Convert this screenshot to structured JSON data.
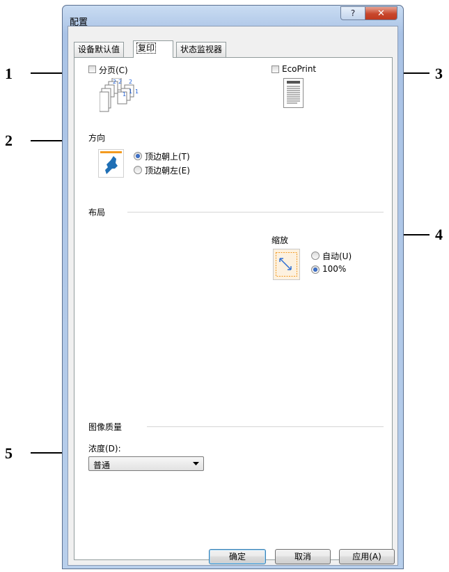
{
  "window": {
    "title": "配置",
    "help_glyph": "?",
    "close_glyph": "✕"
  },
  "tabs": [
    {
      "label": "设备默认值",
      "active": false
    },
    {
      "label": "复印",
      "active": true
    },
    {
      "label": "状态监视器",
      "active": false
    }
  ],
  "collate": {
    "label": "分页(C)",
    "checked": false,
    "sheet_numbers": [
      "2",
      "2",
      "2",
      "1",
      "1",
      "1"
    ]
  },
  "ecoprint": {
    "label": "EcoPrint",
    "checked": false
  },
  "orientation": {
    "heading": "方向",
    "options": [
      {
        "label": "顶边朝上(T)",
        "selected": true
      },
      {
        "label": "顶边朝左(E)",
        "selected": false
      }
    ]
  },
  "layout": {
    "heading": "布局"
  },
  "zoom": {
    "heading": "缩放",
    "options": [
      {
        "label": "自动(U)",
        "selected": false
      },
      {
        "label": "100%",
        "selected": true
      }
    ]
  },
  "image_quality": {
    "heading": "图像质量",
    "density_label": "浓度(D):",
    "density_value": "普通"
  },
  "buttons": {
    "ok": "确定",
    "cancel": "取消",
    "apply": "应用(A)"
  },
  "callouts": [
    "1",
    "2",
    "3",
    "4",
    "5"
  ],
  "colors": {
    "accent_orange": "#f39a1f",
    "icon_blue": "#1f6fb5"
  }
}
